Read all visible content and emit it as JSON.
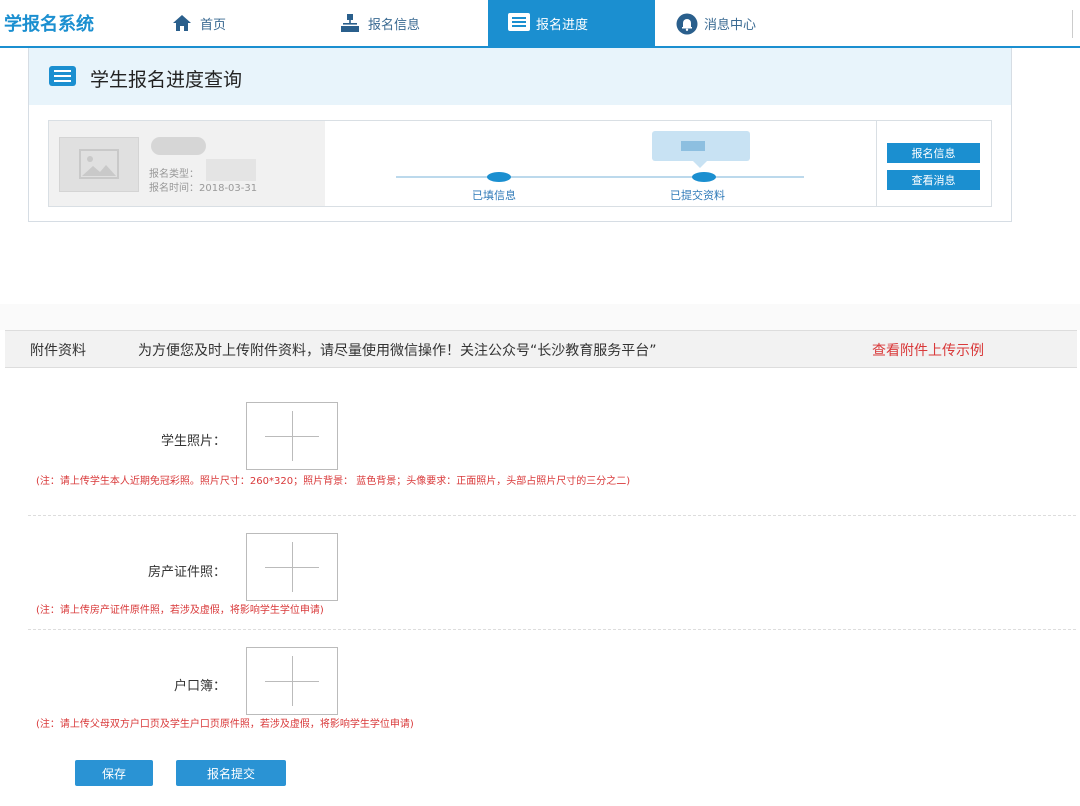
{
  "header": {
    "brand": "学报名系统",
    "nav": [
      {
        "label": "首页",
        "icon": "home-icon"
      },
      {
        "label": "报名信息",
        "icon": "sitemap-icon"
      },
      {
        "label": "报名进度",
        "icon": "list-icon"
      },
      {
        "label": "消息中心",
        "icon": "bell-icon"
      }
    ],
    "active_index": 2
  },
  "progress": {
    "title": "学生报名进度查询",
    "student": {
      "type_label": "报名类型：",
      "time_label": "报名时间：2018-03-31"
    },
    "steps": [
      {
        "label": "已填信息"
      },
      {
        "label": "已提交资料"
      }
    ],
    "buttons": {
      "info": "报名信息",
      "message": "查看消息"
    }
  },
  "attachments": {
    "title": "附件资料",
    "tip": "为方便您及时上传附件资料，请尽量使用微信操作！关注公众号“长沙教育服务平台”",
    "example_link": "查看附件上传示例",
    "fields": [
      {
        "label": "学生照片：",
        "note": "(注：请上传学生本人近期免冠彩照。照片尺寸：260*320；照片背景： 蓝色背景；头像要求：正面照片，头部占照片尺寸的三分之二)"
      },
      {
        "label": "房产证件照：",
        "note": "(注：请上传房产证件原件照，若涉及虚假，将影响学生学位申请)"
      },
      {
        "label": "户口簿：",
        "note": "(注：请上传父母双方户口页及学生户口页原件照，若涉及虚假，将影响学生学位申请)"
      }
    ],
    "save_label": "保存",
    "submit_label": "报名提交"
  },
  "colors": {
    "accent": "#1b8fd0",
    "warning": "#d9393a",
    "panel_head": "#e8f4fb"
  }
}
